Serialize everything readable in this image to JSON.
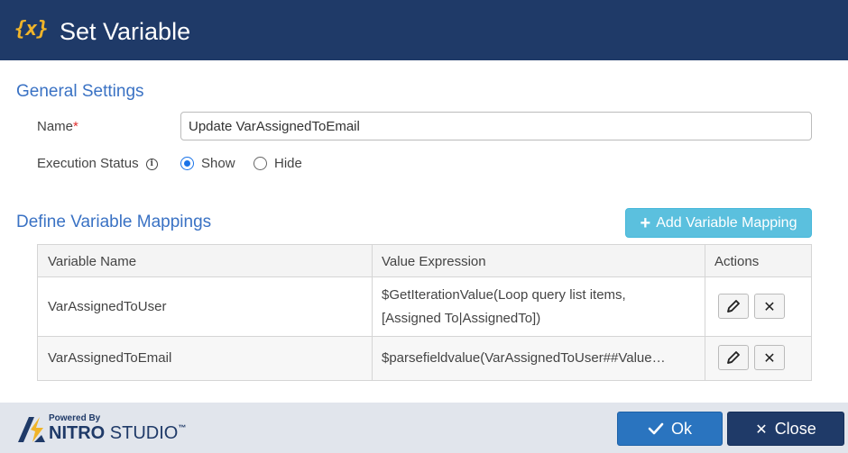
{
  "dialog": {
    "title": "Set Variable",
    "title_icon": "{x}",
    "colors": {
      "header": "#1f3a68",
      "accent": "#3a72c4",
      "info_button": "#5bc0de",
      "ok": "#2a74bf"
    }
  },
  "general": {
    "heading": "General Settings",
    "name_label": "Name",
    "name_required_mark": "*",
    "name_value": "Update VarAssignedToEmail",
    "exec_label": "Execution Status",
    "exec_options": [
      {
        "label": "Show",
        "selected": true
      },
      {
        "label": "Hide",
        "selected": false
      }
    ]
  },
  "mappings": {
    "heading": "Define Variable Mappings",
    "add_label": "Add Variable Mapping",
    "columns": [
      "Variable Name",
      "Value Expression",
      "Actions"
    ],
    "rows": [
      {
        "name": "VarAssignedToUser",
        "expr_line1": "$GetIterationValue(Loop query list items,",
        "expr_line2": "[Assigned To|AssignedTo])"
      },
      {
        "name": "VarAssignedToEmail",
        "expr_line1": "$parsefieldvalue(VarAssignedToUser##Value…",
        "expr_line2": ""
      }
    ]
  },
  "footer": {
    "powered_by": "Powered By",
    "brand_nitro": "NITRO",
    "brand_studio": " STUDIO",
    "brand_tm": "™",
    "ok_label": "Ok",
    "close_label": "Close"
  }
}
